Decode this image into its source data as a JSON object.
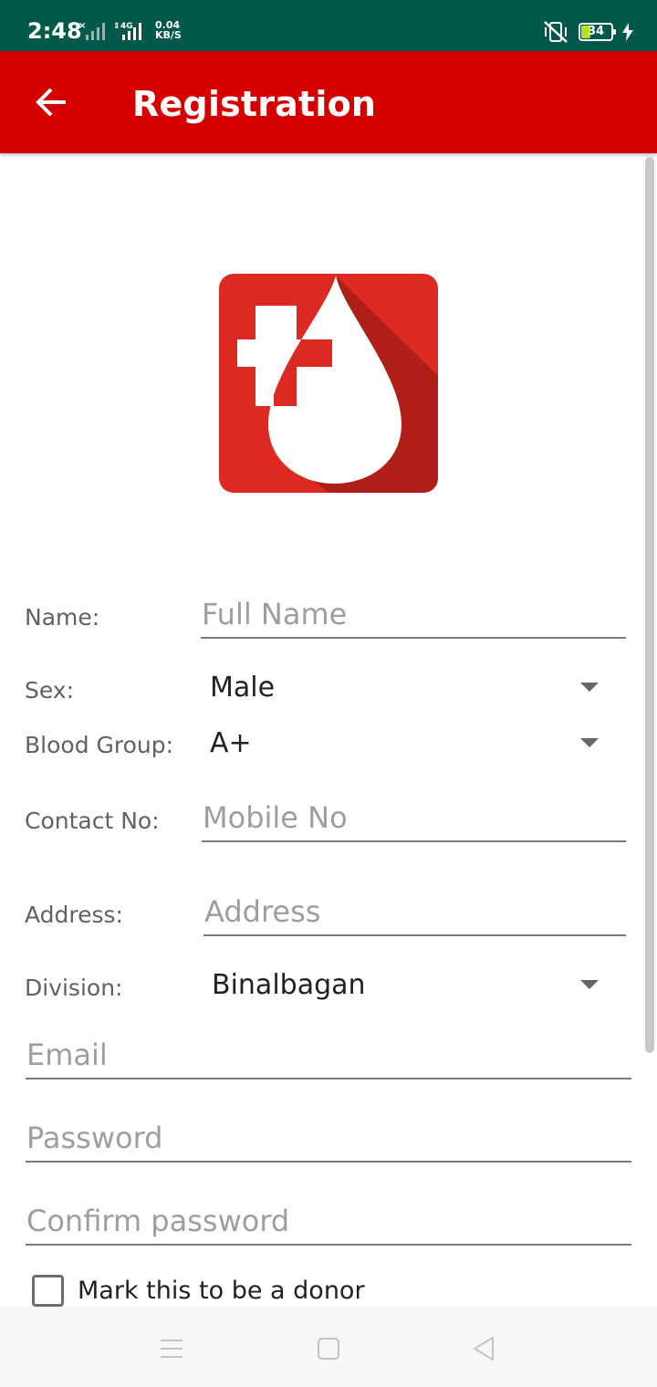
{
  "status_bar": {
    "time": "2:48",
    "network_type": "4G",
    "speed_value": "0.04",
    "speed_unit": "KB/S",
    "battery_level": "34"
  },
  "app_bar": {
    "title": "Registration"
  },
  "form": {
    "name_label": "Name:",
    "name_placeholder": "Full Name",
    "sex_label": "Sex:",
    "sex_value": "Male",
    "blood_group_label": "Blood Group:",
    "blood_group_value": "A+",
    "contact_label": "Contact No:",
    "contact_placeholder": "Mobile No",
    "address_label": "Address:",
    "address_placeholder": "Address",
    "division_label": "Division:",
    "division_value": "Binalbagan",
    "email_placeholder": "Email",
    "password_placeholder": "Password",
    "confirm_password_placeholder": "Confirm password",
    "donor_checkbox_label": "Mark this to be a donor",
    "donor_checked": false
  },
  "colors": {
    "status_bar": "#02594a",
    "app_bar": "#d50000",
    "logo_red": "#dc2a22"
  },
  "icons": {
    "back": "arrow-left-icon",
    "logo": "blood-drop-plus-icon",
    "nav_menu": "menu-icon",
    "nav_home": "square-home-icon",
    "nav_back": "triangle-back-icon"
  }
}
